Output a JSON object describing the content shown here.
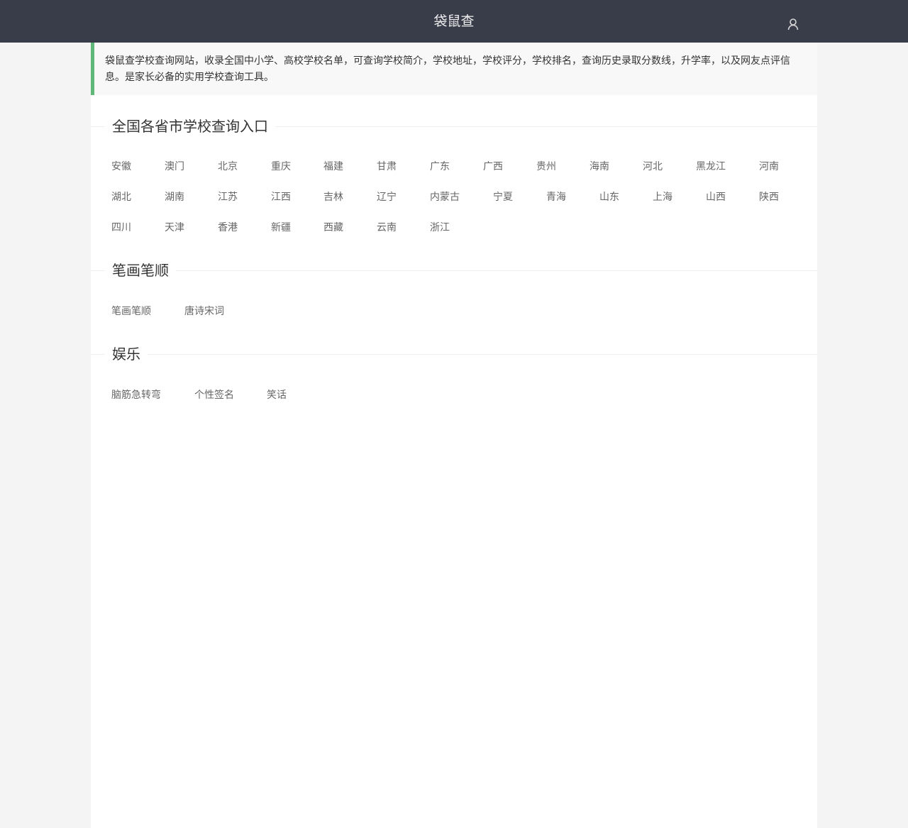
{
  "header": {
    "title": "袋鼠查"
  },
  "intro": {
    "text": "袋鼠查学校查询网站，收录全国中小学、高校学校名单，可查询学校简介，学校地址，学校评分，学校排名，查询历史录取分数线，升学率，以及网友点评信息。是家长必备的实用学校查询工具。"
  },
  "sections": [
    {
      "title": "全国各省市学校查询入口",
      "links": [
        "安徽",
        "澳门",
        "北京",
        "重庆",
        "福建",
        "甘肃",
        "广东",
        "广西",
        "贵州",
        "海南",
        "河北",
        "黑龙江",
        "河南",
        "湖北",
        "湖南",
        "江苏",
        "江西",
        "吉林",
        "辽宁",
        "内蒙古",
        "宁夏",
        "青海",
        "山东",
        "上海",
        "山西",
        "陕西",
        "四川",
        "天津",
        "香港",
        "新疆",
        "西藏",
        "云南",
        "浙江"
      ]
    },
    {
      "title": "笔画笔顺",
      "links": [
        "笔画笔顺",
        "唐诗宋词"
      ]
    },
    {
      "title": "娱乐",
      "links": [
        "脑筋急转弯",
        "个性签名",
        "笑话"
      ]
    }
  ]
}
